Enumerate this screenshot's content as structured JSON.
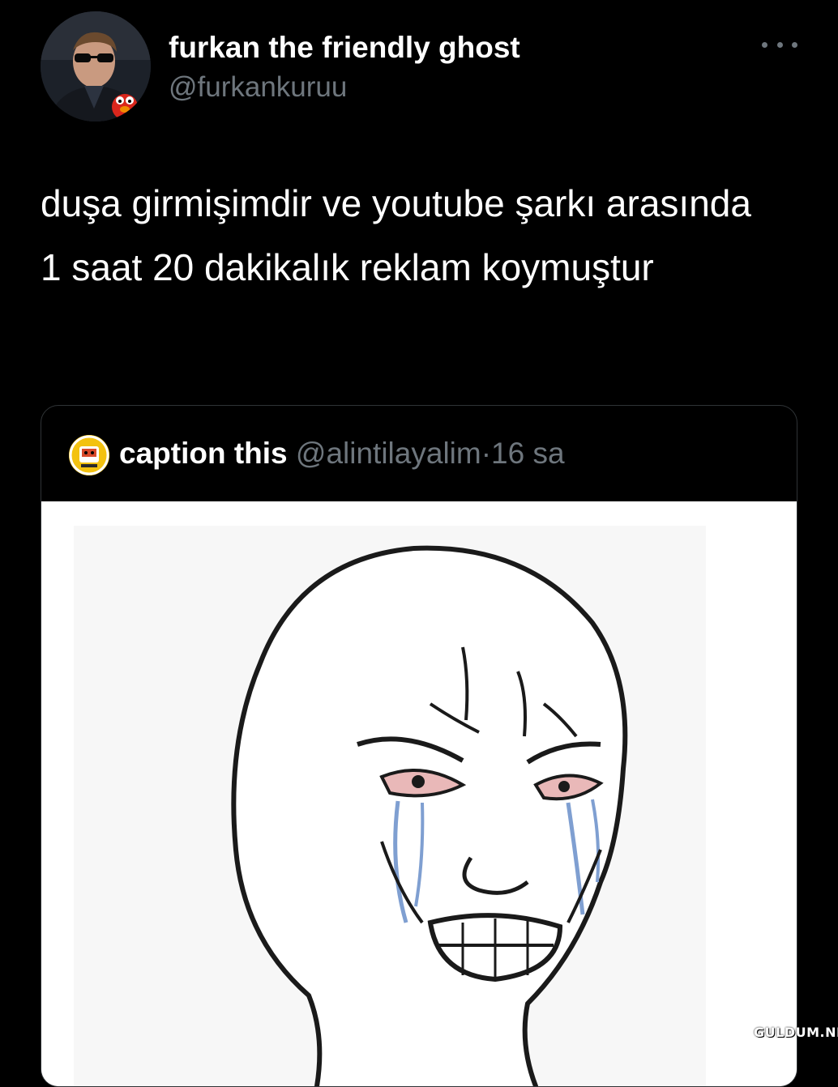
{
  "tweet": {
    "display_name": "furkan the friendly ghost",
    "handle": "@furkankuruu",
    "more_icon": "more-horizontal-icon",
    "text": "duşa girmişimdir ve youtube şarkı arasında 1 saat 20 dakikalık reklam koymuştur"
  },
  "quote": {
    "display_name": "caption this",
    "handle": "@alintilayalim",
    "separator": "·",
    "time": "16 sa",
    "media_description_icon": "crying-wojak-image"
  },
  "watermark": "GULDUM.NET",
  "colors": {
    "background": "#000000",
    "text_primary": "#ffffff",
    "text_secondary": "#6e767d",
    "card_border": "#2f3336"
  }
}
